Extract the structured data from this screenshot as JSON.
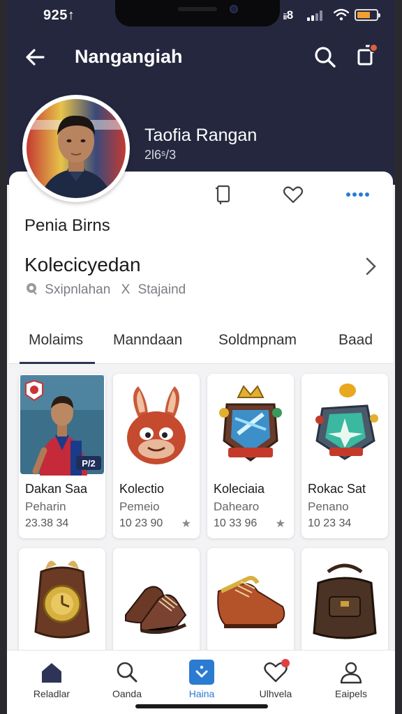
{
  "status_bar": {
    "time": "925↑",
    "carrier": "ᵢᵢ8"
  },
  "app_bar": {
    "title": "Nangangiah"
  },
  "profile": {
    "name": "Taofia Rangan",
    "subtitle": "2Ɩ6ˢ/3"
  },
  "card": {
    "label": "Penia Birns",
    "collection_title": "Kolecicyedan",
    "meta_left": "Sxipnlahan",
    "meta_sep": "X",
    "meta_right": "Stajaind"
  },
  "tabs": [
    {
      "label": "Molaims",
      "active": true
    },
    {
      "label": "Manndaan",
      "active": false
    },
    {
      "label": "Soldmpnam",
      "active": false
    },
    {
      "label": "Baad",
      "active": false
    }
  ],
  "items": [
    {
      "name": "Dakan Saa",
      "sub": "Peharin",
      "num": "23.38 34",
      "star": "",
      "badge": "P/2"
    },
    {
      "name": "Kolectio",
      "sub": "Pemeio",
      "num": "10 23 90",
      "star": "★"
    },
    {
      "name": "Koleciaia",
      "sub": "Dahearo",
      "num": "10 33 96",
      "star": "★"
    },
    {
      "name": "Rokac Sat",
      "sub": "Penano",
      "num": "10 23 34",
      "star": ""
    }
  ],
  "bottom_nav": [
    {
      "label": "Reladlar",
      "icon": "home-icon"
    },
    {
      "label": "Oanda",
      "icon": "search-icon"
    },
    {
      "label": "Haina",
      "icon": "download-icon",
      "active": true
    },
    {
      "label": "Ulhvela",
      "icon": "heart-icon"
    },
    {
      "label": "Eaipels",
      "icon": "user-icon"
    }
  ],
  "colors": {
    "header": "#25273f",
    "accent": "#2b7bd1",
    "card_bg": "#ffffff"
  }
}
